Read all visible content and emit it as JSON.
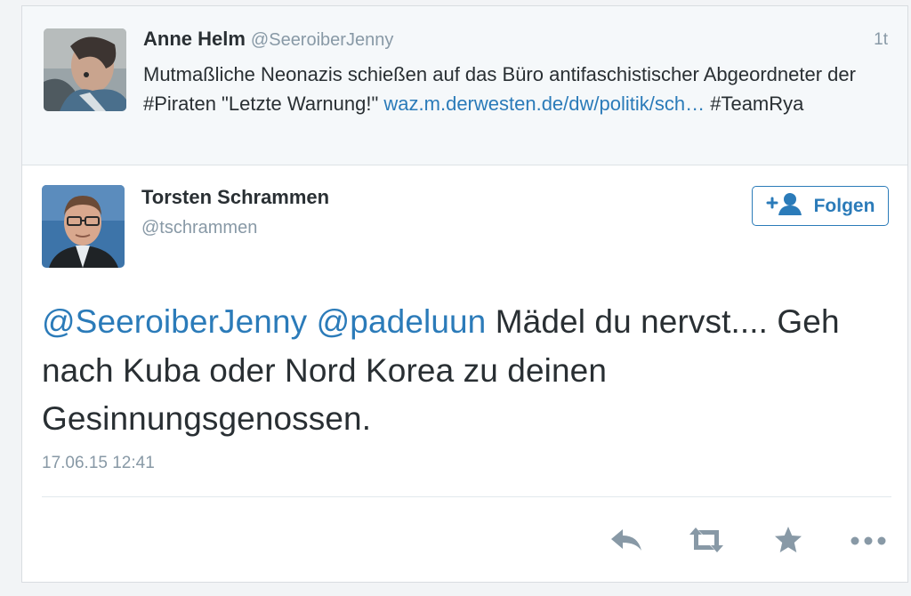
{
  "context_tweet": {
    "author_name": "Anne Helm",
    "author_handle": "@SeeroiberJenny",
    "time": "1t",
    "text_plain_1": "Mutmaßliche Neonazis schießen auf das Büro antifaschistischer Abgeordneter der #Piraten \"Letzte Warnung!\" ",
    "link_text": "waz.m.derwesten.de/dw/politik/sch…",
    "text_plain_2": " #TeamRya"
  },
  "main_tweet": {
    "author_name": "Torsten Schrammen",
    "author_handle": "@tschrammen",
    "follow_label": "Folgen",
    "mention_1": "@SeeroiberJenny",
    "mention_2": "@padeluun",
    "body": " Mädel du nervst.... Geh nach Kuba oder Nord Korea zu deinen Gesinnungsgenossen.",
    "timestamp": "17.06.15 12:41"
  },
  "actions": {
    "reply_icon": "reply-icon",
    "retweet_icon": "retweet-icon",
    "favorite_icon": "star-icon",
    "more_icon": "more-icon"
  },
  "colors": {
    "link": "#2b7bb9",
    "icon": "#8899a6",
    "text": "#292f33"
  }
}
